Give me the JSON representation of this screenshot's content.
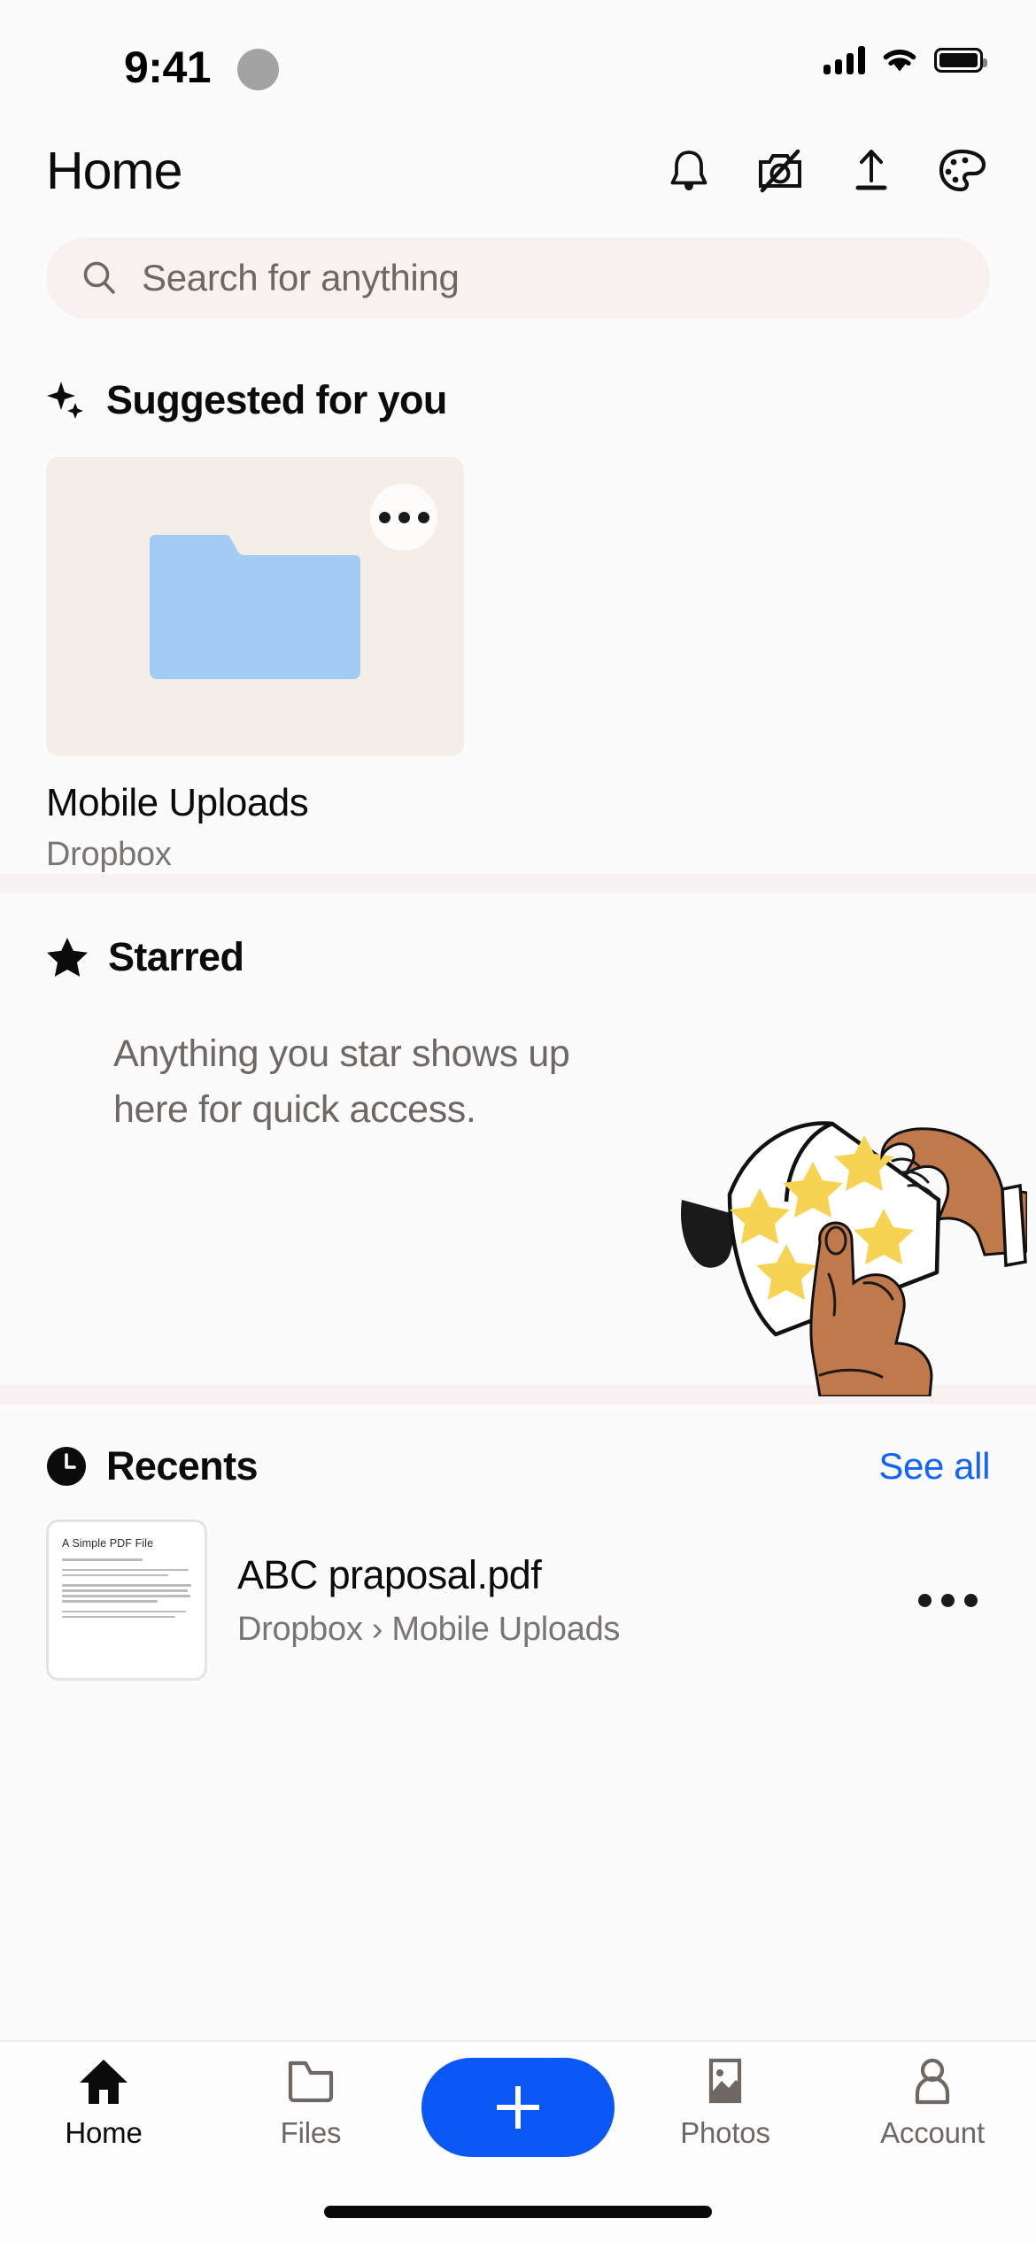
{
  "status_bar": {
    "time": "9:41",
    "icons": [
      "camera-indicator-dot",
      "cellular-signal-icon",
      "wifi-icon",
      "battery-icon"
    ],
    "battery_level": "100"
  },
  "header": {
    "title": "Home",
    "actions": [
      {
        "name": "notifications",
        "icon": "bell-icon"
      },
      {
        "name": "camera-uploads-off",
        "icon": "camera-off-icon"
      },
      {
        "name": "upload",
        "icon": "upload-icon"
      },
      {
        "name": "theme",
        "icon": "palette-icon"
      }
    ]
  },
  "search": {
    "placeholder": "Search for anything",
    "value": "",
    "icon": "search-icon"
  },
  "suggested": {
    "title": "Suggested for you",
    "icon": "sparkles-icon",
    "card": {
      "name": "Mobile Uploads",
      "location": "Dropbox",
      "type": "folder",
      "folder_color": "#A3CCF5",
      "card_color": "#F5EDE7",
      "overflow_label": "More options"
    }
  },
  "starred": {
    "title": "Starred",
    "icon": "star-icon",
    "empty_message": "Anything you star shows up here for quick access.",
    "illustration": "hands-peeling-star-stickers",
    "star_color": "#F7D354",
    "skin_color": "#C0794B"
  },
  "recents": {
    "title": "Recents",
    "icon": "clock-icon",
    "see_all_label": "See all",
    "see_all_color": "#1262FF",
    "files": [
      {
        "name": "ABC praposal.pdf",
        "path": "Dropbox › Mobile Uploads",
        "thumbnail_title": "A Simple PDF File",
        "thumbnail_type": "pdf-page",
        "overflow_label": "More options"
      }
    ]
  },
  "tabbar": {
    "items": [
      {
        "label": "Home",
        "icon": "home-icon",
        "active": true
      },
      {
        "label": "Files",
        "icon": "folder-icon",
        "active": false
      },
      {
        "label": "",
        "icon": "plus-icon",
        "active": false,
        "is_fab": true
      },
      {
        "label": "Photos",
        "icon": "photo-icon",
        "active": false
      },
      {
        "label": "Account",
        "icon": "person-icon",
        "active": false
      }
    ],
    "fab_color": "#0B57F5"
  }
}
